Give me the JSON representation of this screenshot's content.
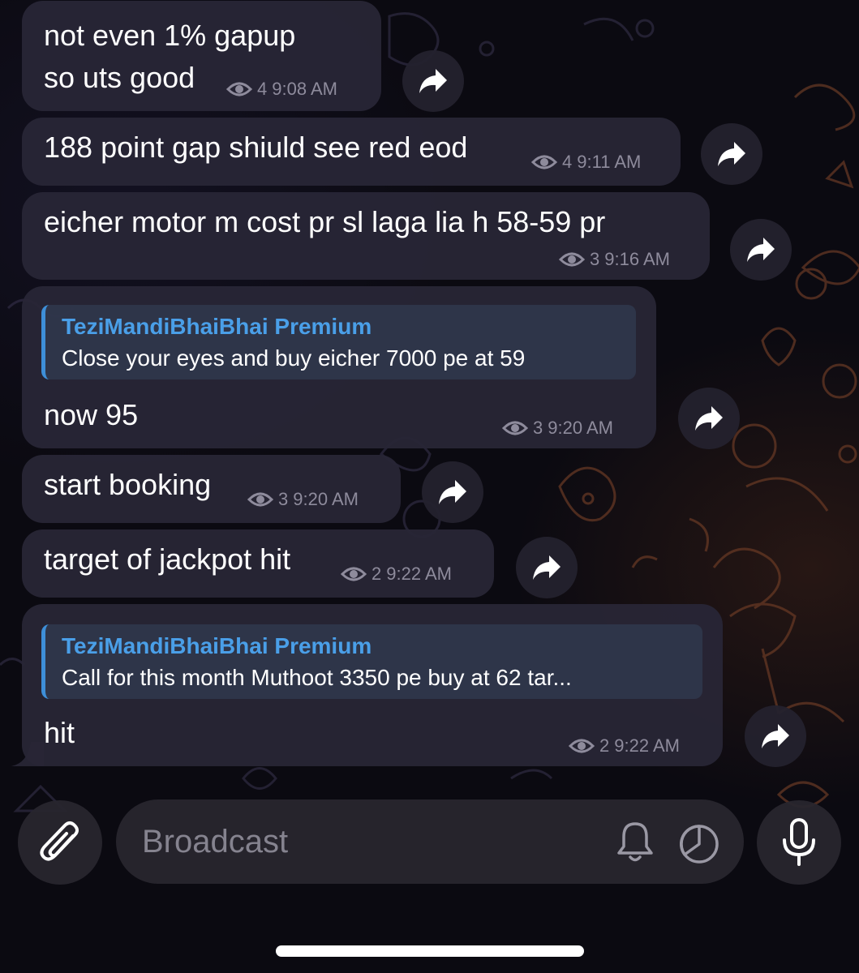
{
  "messages": [
    {
      "text_lines": [
        "not even 1% gapup",
        "so uts good"
      ],
      "views": "4",
      "time": "9:08 AM"
    },
    {
      "text": "188 point gap shiuld see red eod",
      "views": "4",
      "time": "9:11 AM"
    },
    {
      "text": "eicher motor m cost pr sl laga lia h 58-59 pr",
      "views": "3",
      "time": "9:16 AM"
    },
    {
      "reply_author": "TeziMandiBhaiBhai Premium",
      "reply_text": "Close your eyes and buy eicher 7000 pe at 59",
      "text": "now 95",
      "views": "3",
      "time": "9:20 AM"
    },
    {
      "text": "start booking",
      "views": "3",
      "time": "9:20 AM"
    },
    {
      "text": "target of jackpot hit",
      "views": "2",
      "time": "9:22 AM"
    },
    {
      "reply_author": "TeziMandiBhaiBhai Premium",
      "reply_text": "Call for this month Muthoot 3350 pe buy at 62 tar...",
      "text": "hit",
      "views": "2",
      "time": "9:22 AM"
    }
  ],
  "composer": {
    "placeholder": "Broadcast",
    "attach_icon": "paperclip-icon",
    "bell_icon": "bell-icon",
    "timer_icon": "auto-delete-timer-icon",
    "mic_icon": "microphone-icon"
  },
  "colors": {
    "background": "#0b0a11",
    "bubble": "#282636",
    "reply_accent": "#3e8fd8",
    "reply_author": "#4a9fe8",
    "meta_text": "#8e8b9c"
  }
}
